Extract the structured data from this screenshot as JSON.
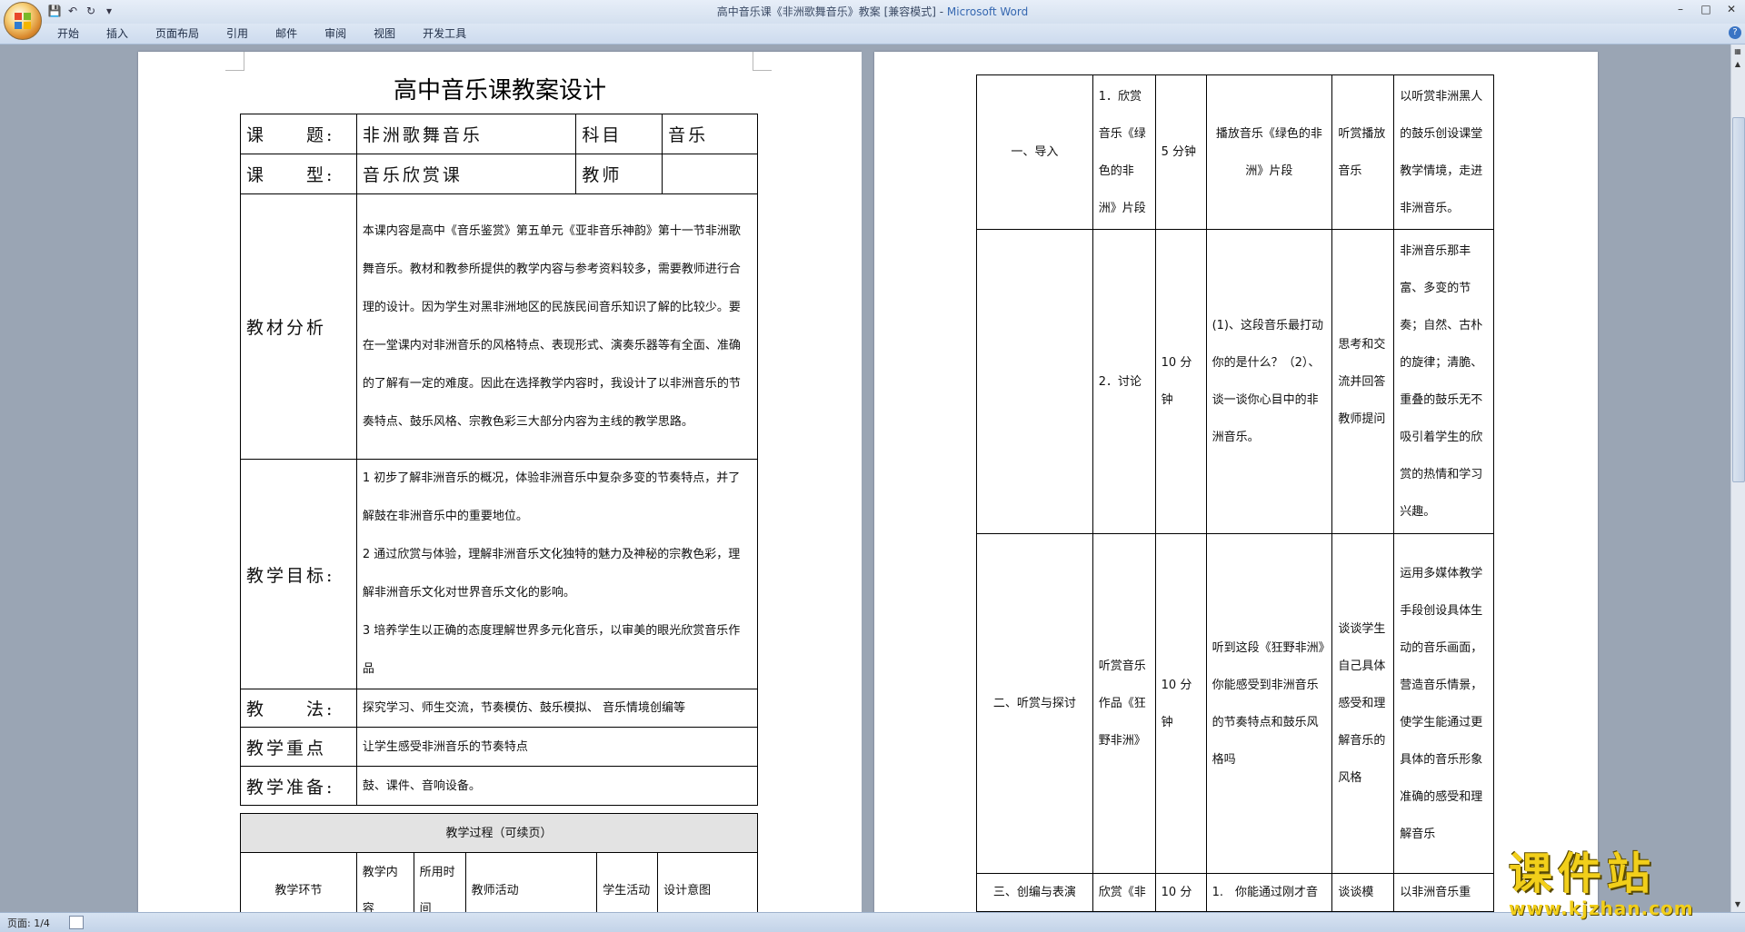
{
  "window": {
    "title_doc": "高中音乐课《非洲歌舞音乐》教案 [兼容模式] - ",
    "title_app": "Microsoft Word"
  },
  "ribbon": {
    "tabs": [
      "开始",
      "插入",
      "页面布局",
      "引用",
      "邮件",
      "审阅",
      "视图",
      "开发工具"
    ]
  },
  "page1": {
    "title": "高中音乐课教案设计",
    "rows": {
      "topic_label": "课　　题:",
      "topic_value": "非洲歌舞音乐",
      "subject_label": "科目",
      "subject_value": "音乐",
      "type_label": "课　　型:",
      "type_value": "音乐欣赏课",
      "teacher_label": "教师",
      "teacher_value": "",
      "analysis_label": "教材分析",
      "analysis_text": "本课内容是高中《音乐鉴赏》第五单元《亚非音乐神韵》第十一节非洲歌舞音乐。教材和教参所提供的教学内容与参考资料较多，需要教师进行合理的设计。因为学生对黑非洲地区的民族民间音乐知识了解的比较少。要在一堂课内对非洲音乐的风格特点、表现形式、演奏乐器等有全面、准确的了解有一定的难度。因此在选择教学内容时，我设计了以非洲音乐的节奏特点、鼓乐风格、宗教色彩三大部分内容为主线的教学思路。",
      "goals_label": "教学目标:",
      "goal1": "1 初步了解非洲音乐的概况，体验非洲音乐中复杂多变的节奏特点，并了解鼓在非洲音乐中的重要地位。",
      "goal2": "2 通过欣赏与体验，理解非洲音乐文化独特的魅力及神秘的宗教色彩，理解非洲音乐文化对世界音乐文化的影响。",
      "goal3": "3 培养学生以正确的态度理解世界多元化音乐，以审美的眼光欣赏音乐作品",
      "method_label": "教　　法:",
      "method_text": "探究学习、师生交流，节奏模仿、鼓乐模拟、 音乐情境创编等",
      "focus_label": "教学重点",
      "focus_text": "让学生感受非洲音乐的节奏特点",
      "prep_label": "教学准备:",
      "prep_text": "鼓、课件、音响设备。",
      "process_header": "教学过程（可续页）",
      "h_link": "教学环节",
      "h_content": "教学内容",
      "h_time": "所用时间",
      "h_teacher": "教师活动",
      "h_student": "学生活动",
      "h_intent": "设计意图"
    }
  },
  "page2": {
    "rows": [
      {
        "link": "一、导入",
        "content": "1．欣赏音乐《绿色的非洲》片段",
        "time": "5 分钟",
        "teacher": "播放音乐《绿色的非洲》片段",
        "student": "听赏播放音乐",
        "intent": "以听赏非洲黑人的鼓乐创设课堂教学情境，走进非洲音乐。"
      },
      {
        "link": "",
        "content": "2．讨论",
        "time": "10 分钟",
        "teacher": "(1)、这段音乐最打动你的是什么？（2）、谈一谈你心目中的非洲音乐。",
        "student": "思考和交流并回答教师提问",
        "intent": "非洲音乐那丰富、多变的节奏；自然、古朴的旋律；清脆、重叠的鼓乐无不吸引着学生的欣赏的热情和学习兴趣。"
      },
      {
        "link": "二、听赏与探讨",
        "content": "听赏音乐作品《狂野非洲》",
        "time": "10 分钟",
        "teacher": "听到这段《狂野非洲》你能感受到非洲音乐的节奏特点和鼓乐风格吗",
        "student": "谈谈学生自己具体感受和理解音乐的风格",
        "intent": "运用多媒体教学手段创设具体生动的音乐画面，营造音乐情景，使学生能通过更具体的音乐形象准确的感受和理解音乐"
      },
      {
        "link": "三、创编与表演",
        "content": "欣赏《非",
        "time": "10 分",
        "teacher": "1.　你能通过刚才音",
        "student": "谈谈模",
        "intent": "以非洲音乐重"
      }
    ]
  },
  "statusbar": {
    "page": "页面: 1/4"
  },
  "watermark": {
    "title": "课件站",
    "url": "www.kjzhan.com"
  }
}
